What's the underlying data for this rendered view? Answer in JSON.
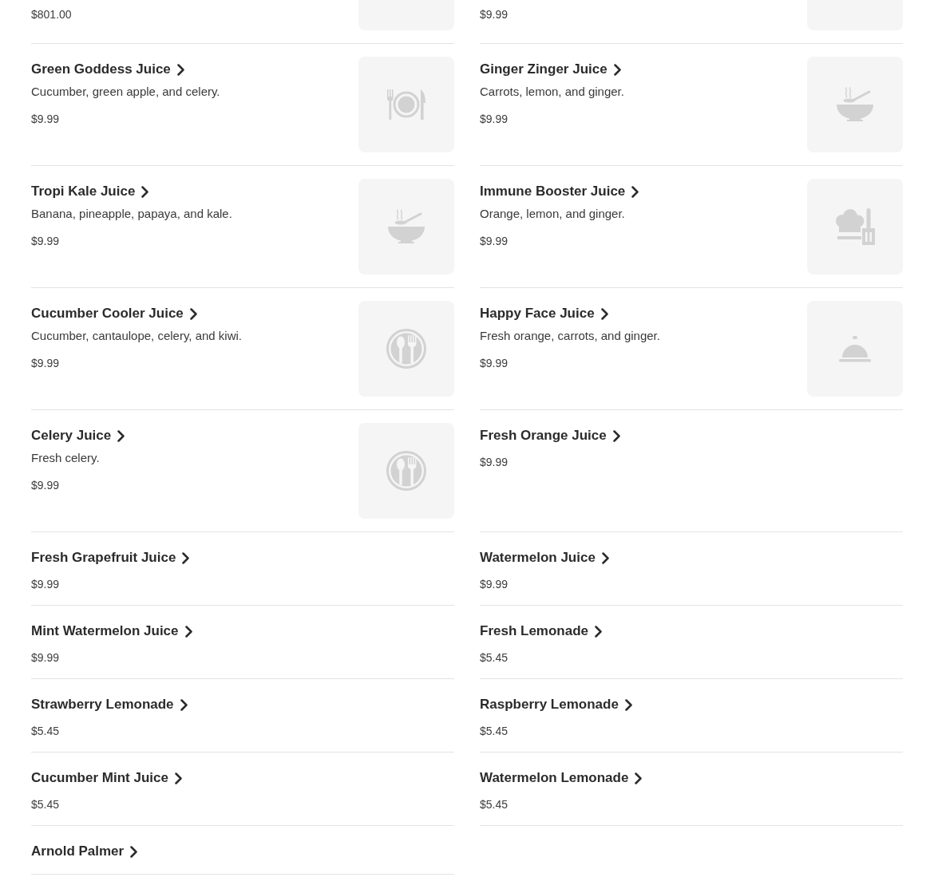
{
  "menu_items": [
    {
      "kind": "partial",
      "price": "$801.00",
      "image": {
        "kind": "empty"
      }
    },
    {
      "kind": "partial",
      "price": "$9.99",
      "image": {
        "kind": "empty"
      }
    },
    {
      "kind": "item",
      "name": "Green Goddess Juice",
      "description": "Cucumber, green apple, and celery.",
      "price": "$9.99",
      "image": {
        "kind": "plate"
      }
    },
    {
      "kind": "item",
      "name": "Ginger Zinger Juice",
      "description": "Carrots, lemon, and ginger.",
      "price": "$9.99",
      "image": {
        "kind": "bowl"
      }
    },
    {
      "kind": "item",
      "name": "Tropi Kale Juice",
      "description": "Banana, pineapple, papaya, and kale.",
      "price": "$9.99",
      "image": {
        "kind": "bowl"
      }
    },
    {
      "kind": "item",
      "name": "Immune Booster Juice",
      "description": "Orange, lemon, and ginger.",
      "price": "$9.99",
      "image": {
        "kind": "chef"
      }
    },
    {
      "kind": "item",
      "name": "Cucumber Cooler Juice",
      "description": "Cucumber, cantaulope, celery, and kiwi.",
      "price": "$9.99",
      "image": {
        "kind": "utensils"
      }
    },
    {
      "kind": "item",
      "name": "Happy Face Juice",
      "description": "Fresh orange, carrots, and ginger.",
      "price": "$9.99",
      "image": {
        "kind": "cloche"
      }
    },
    {
      "kind": "item",
      "name": "Celery Juice",
      "description": "Fresh celery.",
      "price": "$9.99",
      "image": {
        "kind": "utensils"
      }
    },
    {
      "kind": "item",
      "name": "Fresh Orange Juice",
      "price": "$9.99"
    },
    {
      "kind": "item",
      "name": "Fresh Grapefruit Juice",
      "price": "$9.99"
    },
    {
      "kind": "item",
      "name": "Watermelon Juice",
      "price": "$9.99"
    },
    {
      "kind": "item",
      "name": "Mint Watermelon Juice",
      "price": "$9.99"
    },
    {
      "kind": "item",
      "name": "Fresh Lemonade",
      "price": "$5.45"
    },
    {
      "kind": "item",
      "name": "Strawberry Lemonade",
      "price": "$5.45"
    },
    {
      "kind": "item",
      "name": "Raspberry Lemonade",
      "price": "$5.45"
    },
    {
      "kind": "item",
      "name": "Cucumber Mint Juice",
      "price": "$5.45"
    },
    {
      "kind": "item",
      "name": "Watermelon Lemonade",
      "price": "$5.45"
    },
    {
      "kind": "item",
      "name": "Arnold Palmer"
    }
  ]
}
